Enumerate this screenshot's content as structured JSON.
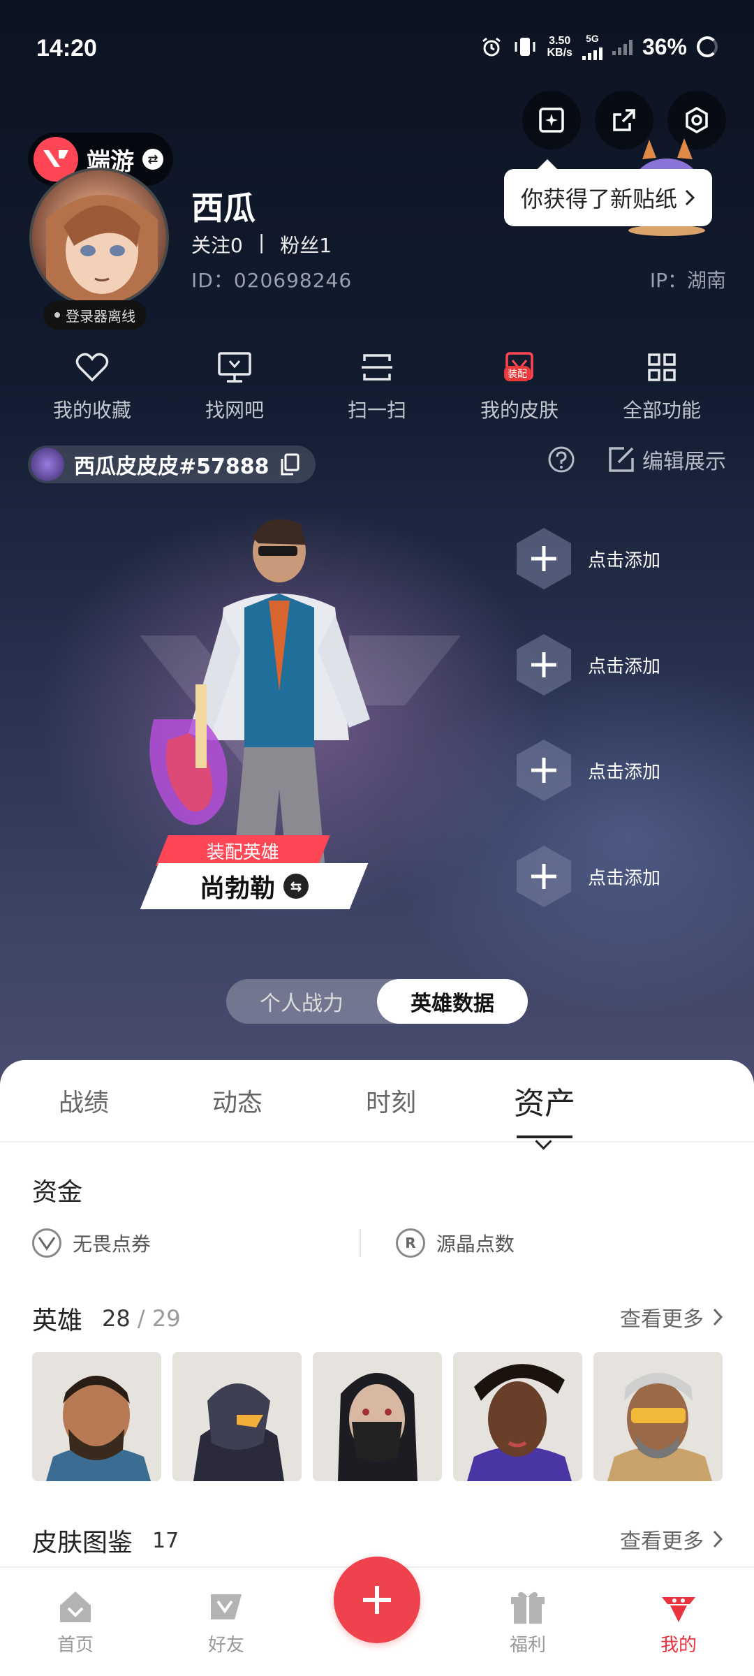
{
  "status_bar": {
    "time": "14:20",
    "net_speed_value": "3.50",
    "net_speed_unit": "KB/s",
    "network": "5G",
    "battery": "36%"
  },
  "header": {
    "app_switch_label": "端游",
    "sticker_tip": "你获得了新贴纸",
    "offline_status": "登录器离线"
  },
  "profile": {
    "name": "西瓜",
    "follow_label": "关注",
    "follow_count": "0",
    "fans_label": "粉丝",
    "fans_count": "1",
    "id": "ID：020698246",
    "ip": "IP：湖南"
  },
  "quick_menu": [
    {
      "label": "我的收藏",
      "icon": "heart-icon"
    },
    {
      "label": "找网吧",
      "icon": "monitor-icon"
    },
    {
      "label": "扫一扫",
      "icon": "scan-icon"
    },
    {
      "label": "我的皮肤",
      "icon": "skin-icon",
      "badge": "装配"
    },
    {
      "label": "全部功能",
      "icon": "grid-icon"
    }
  ],
  "player_tag": "西瓜皮皮皮#57888",
  "edit_display": "编辑展示",
  "showcase": {
    "equip_label": "装配英雄",
    "hero_name": "尚勃勒",
    "add_slots": [
      "点击添加",
      "点击添加",
      "点击添加",
      "点击添加"
    ],
    "segments": [
      "个人战力",
      "英雄数据"
    ],
    "active_segment": 1
  },
  "tabs": [
    "战绩",
    "动态",
    "时刻",
    "资产"
  ],
  "active_tab": 3,
  "assets": {
    "funds_title": "资金",
    "funds": [
      "无畏点券",
      "源晶点数"
    ],
    "heroes_title": "英雄",
    "heroes_owned": "28",
    "heroes_total": "29",
    "heroes_more": "查看更多",
    "skins_title": "皮肤图鉴",
    "skins_count": "17",
    "skins_more": "查看更多"
  },
  "bottom_nav": [
    {
      "label": "首页",
      "icon": "home-icon"
    },
    {
      "label": "好友",
      "icon": "friends-icon"
    },
    {
      "label": "福利",
      "icon": "gift-icon"
    },
    {
      "label": "我的",
      "icon": "profile-icon"
    }
  ],
  "bottom_nav_active": 3,
  "colors": {
    "accent": "#ff4655",
    "active_nav": "#e8343e",
    "fab": "#f0424c"
  }
}
